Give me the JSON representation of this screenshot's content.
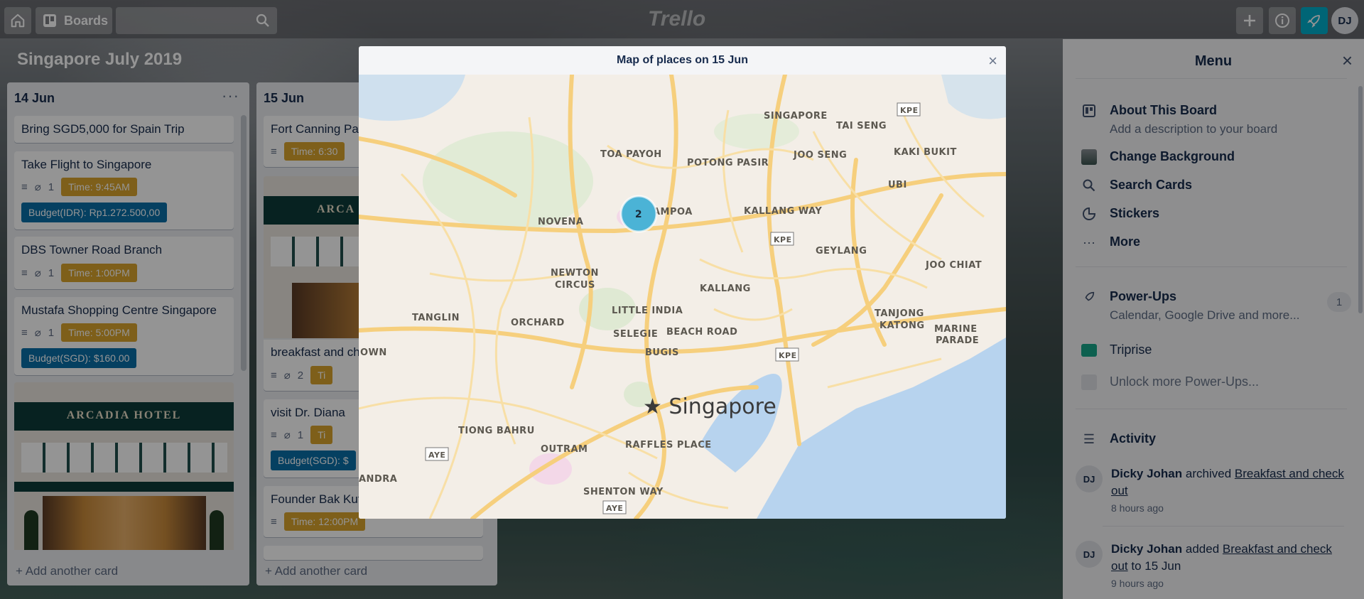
{
  "header": {
    "boards_label": "Boards",
    "logo": "Trello",
    "avatar_initials": "DJ",
    "icons": [
      "home-icon",
      "board-icon",
      "search-icon",
      "plus-icon",
      "info-icon",
      "rocket-icon"
    ]
  },
  "board": {
    "title": "Singapore July 2019"
  },
  "lists": [
    {
      "title": "14 Jun",
      "add_card": "+ Add another card",
      "cards": [
        {
          "title": "Bring SGD5,000 for Spain Trip"
        },
        {
          "title": "Take Flight to Singapore",
          "attachments": "1",
          "time": "Time: 9:45AM",
          "budget": "Budget(IDR): Rp1.272.500,00"
        },
        {
          "title": "DBS Towner Road Branch",
          "attachments": "1",
          "time": "Time: 1:00PM"
        },
        {
          "title": "Mustafa Shopping Centre Singapore",
          "attachments": "1",
          "time": "Time: 5:00PM",
          "budget": "Budget(SGD): $160.00"
        },
        {
          "cover": "ARCADIA HOTEL"
        }
      ]
    },
    {
      "title": "15 Jun",
      "add_card": "+ Add another card",
      "cards": [
        {
          "title": "Fort Canning Pa",
          "time": "Time: 6:30"
        },
        {
          "cover": "ARCA"
        },
        {
          "title": "breakfast and ch",
          "attachments": "2",
          "time": "Ti"
        },
        {
          "title": "visit Dr. Diana",
          "attachments": "1",
          "time": "Ti",
          "budget": "Budget(SGD): $"
        },
        {
          "title": "Founder Bak Kut",
          "time": "Time: 12:00PM"
        }
      ]
    }
  ],
  "modal": {
    "title": "Map of places on 15 Jun",
    "close": "×",
    "cluster_count": "2",
    "places": [
      "SINGAPORE",
      "TAI SENG",
      "TOA PAYOH",
      "POTONG PASIR",
      "JOO SENG",
      "KAKI BUKIT",
      "UBI",
      "NOVENA",
      "AMPOA",
      "KALLANG WAY",
      "GEYLANG",
      "NEWTON",
      "CIRCUS",
      "JOO CHIAT",
      "KALLANG",
      "TANGLIN",
      "ORCHARD",
      "LITTLE INDIA",
      "TANJONG",
      "KATONG",
      "MARINE",
      "PARADE",
      "SELEGIE",
      "BEACH ROAD",
      "BUGIS",
      "Singapore",
      "TIONG BAHRU",
      "OUTRAM",
      "RAFFLES PLACE",
      "SHENTON WAY",
      "ANDRA",
      "KPE",
      "AYE",
      "OWN"
    ]
  },
  "menu": {
    "title": "Menu",
    "close": "×",
    "items": [
      {
        "label": "About This Board",
        "sub": "Add a description to your board"
      },
      {
        "label": "Change Background"
      },
      {
        "label": "Search Cards"
      },
      {
        "label": "Stickers"
      },
      {
        "label": "More"
      }
    ],
    "powerups": {
      "label": "Power-Ups",
      "sub": "Calendar, Google Drive and more...",
      "count": "1"
    },
    "triprise": "Triprise",
    "unlock": "Unlock more Power-Ups...",
    "activity_title": "Activity",
    "activity": [
      {
        "user": "Dicky Johan",
        "initials": "DJ",
        "verb": "archived",
        "target": "Breakfast and check out",
        "tail": "",
        "time": "8 hours ago"
      },
      {
        "user": "Dicky Johan",
        "initials": "DJ",
        "verb": "added",
        "target": "Breakfast and check out",
        "tail": "to 15 Jun",
        "time": "9 hours ago"
      }
    ]
  }
}
